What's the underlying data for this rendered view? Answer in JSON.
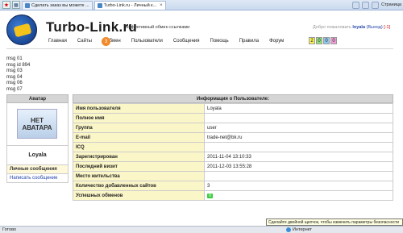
{
  "browser": {
    "tabs": [
      {
        "label": "Сделать заказ вы можете ...",
        "active": false
      },
      {
        "label": "Turbo-Link.ru - Личный к...",
        "active": true
      }
    ],
    "page_menu": "Страница",
    "status_text": "Готово",
    "zone_text": "Интернет",
    "tooltip": "Сделайте двойной щелчок, чтобы изменить параметры безопасности"
  },
  "site": {
    "name": "Turbo-Link.ru",
    "slogan": "Эффективный обмен ссылками",
    "welcome": "Добро пожаловать",
    "username": "loyala",
    "logout": "(Выход)",
    "bad": "[-1]",
    "nav": [
      "Главная",
      "Сайты",
      "Обмен",
      "Пользователи",
      "Сообщения",
      "Помощь",
      "Правила",
      "Форум"
    ],
    "nav_badge": "3",
    "counters": [
      "2",
      "0",
      "0",
      "0"
    ]
  },
  "debug_messages": [
    "msg 01",
    "msg id 894",
    "msg 03",
    "msg 04",
    "msg 06",
    "msg 07"
  ],
  "left_panel": {
    "header": "Аватар",
    "avatar_line1": "НЕТ",
    "avatar_line2": "АВАТАРА",
    "username": "Loyala",
    "menu": [
      "Личные сообщения",
      "Написать сообщение"
    ]
  },
  "profile": {
    "header": "Информация о Пользователе:",
    "rows": [
      {
        "label": "Имя пользователя",
        "value": "Loyala"
      },
      {
        "label": "Полное имя",
        "value": ""
      },
      {
        "label": "Группа",
        "value": "user"
      },
      {
        "label": "E-mail",
        "value": "trade-net@bk.ru"
      },
      {
        "label": "ICQ",
        "value": ""
      },
      {
        "label": "Зарегистрирован",
        "value": "2011-11-04 13:10:33"
      },
      {
        "label": "Последний визит",
        "value": "2011-12-03 13:55:28"
      },
      {
        "label": "Место жительства",
        "value": ""
      },
      {
        "label": "Количество добавленных сайтов",
        "value": "3"
      },
      {
        "label": "Успешных обменов",
        "value": "0"
      }
    ]
  }
}
